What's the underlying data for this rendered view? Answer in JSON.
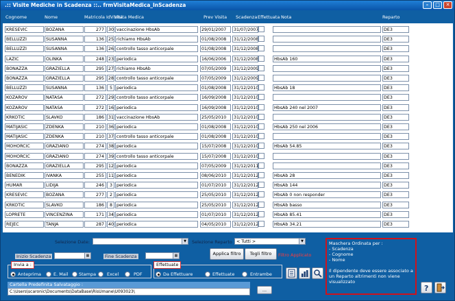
{
  "window": {
    "title": ".:: Visite Mediche in Scadenza ::..   frmVisitaMedica_InScadenza"
  },
  "table": {
    "headers": [
      "Cognome",
      "Nome",
      "Matricola",
      "IdVisita",
      "Visita Medica",
      "Prev Visita",
      "Scadenza",
      "Effettuata",
      "Nota",
      "Reparto"
    ],
    "rows": [
      [
        "KRESEVIC",
        "BOZANA",
        "277",
        "30",
        "vaccinazione HbsAb",
        "29/01/2007",
        "31/07/2007",
        "",
        "DE3"
      ],
      [
        "BELLUZZI",
        "SUSANNA",
        "136",
        "25",
        "richiamo HbsAb",
        "01/08/2008",
        "31/12/2008",
        "",
        "DE3"
      ],
      [
        "BELLUZZI",
        "SUSANNA",
        "136",
        "26",
        "controllo tasso anticorpale",
        "01/08/2008",
        "31/12/2008",
        "",
        "DE3"
      ],
      [
        "LAZIC",
        "OLINKA",
        "248",
        "23",
        "periodica",
        "16/06/2006",
        "31/12/2008",
        "HbsAb 160",
        "DE3"
      ],
      [
        "BONAZZA",
        "GRAZIELLA",
        "295",
        "27",
        "richiamo HbsAb",
        "07/05/2009",
        "31/12/2009",
        "",
        "DE3"
      ],
      [
        "BONAZZA",
        "GRAZIELLA",
        "295",
        "28",
        "controllo tasso anticorpale",
        "07/05/2009",
        "31/12/2009",
        "",
        "DE3"
      ],
      [
        "BELLUZZI",
        "SUSANNA",
        "136",
        "5",
        "periodica",
        "01/08/2008",
        "31/12/2010",
        "HbsAb 18",
        "DE3"
      ],
      [
        "KOZAROV",
        "NATASA",
        "272",
        "29",
        "controllo tasso anticorpale",
        "16/09/2008",
        "31/12/2010",
        "",
        "DE3"
      ],
      [
        "KOZAROV",
        "NATASA",
        "272",
        "16",
        "periodica",
        "16/09/2008",
        "31/12/2010",
        "HbsAb 240 nel 2007",
        "DE3"
      ],
      [
        "KRKOTIC",
        "SLAVKO",
        "186",
        "31",
        "vaccinazione HbsAb",
        "25/05/2010",
        "31/12/2010",
        "",
        "DE3"
      ],
      [
        "MATIJASIC",
        "ZDENKA",
        "210",
        "36",
        "periodica",
        "01/08/2008",
        "31/12/2010",
        "HbsAb 250 nel 2006",
        "DE3"
      ],
      [
        "MATIJASIC",
        "ZDENKA",
        "210",
        "37",
        "controllo tasso anticorpale",
        "01/08/2008",
        "31/12/2010",
        "",
        "DE3"
      ],
      [
        "MOHORCIC",
        "GRAZIANO",
        "274",
        "38",
        "periodica",
        "15/07/2008",
        "31/12/2010",
        "HbsAb 54.85",
        "DE3"
      ],
      [
        "MOHORCIC",
        "GRAZIANO",
        "274",
        "39",
        "controllo tasso anticorpale",
        "15/07/2008",
        "31/12/2010",
        "",
        "DE3"
      ],
      [
        "BONAZZA",
        "GRAZIELLA",
        "295",
        "12",
        "periodica",
        "07/05/2009",
        "31/12/2011",
        "",
        "DE3"
      ],
      [
        "BENEDIK",
        "IVANKA",
        "255",
        "11",
        "periodica",
        "08/06/2010",
        "31/12/2012",
        "HbsAb 28",
        "DE3"
      ],
      [
        "HUMAR",
        "LIDIJA",
        "246",
        "3",
        "periodica",
        "01/07/2010",
        "31/12/2012",
        "HbsAb 144",
        "DE3"
      ],
      [
        "KRESEVIC",
        "BOZANA",
        "277",
        "2",
        "periodica",
        "25/05/2010",
        "31/12/2012",
        "HbsAb 0 non responder",
        "DE3"
      ],
      [
        "KRKOTIC",
        "SLAVKO",
        "186",
        "8",
        "periodica",
        "25/05/2010",
        "31/12/2012",
        "HbsAb basso",
        "DE3"
      ],
      [
        "LOPRETE",
        "VINCENZINA",
        "171",
        "34",
        "periodica",
        "01/07/2010",
        "31/12/2012",
        "HbsAb 85.41",
        "DE3"
      ],
      [
        "REJEC",
        "TANJA",
        "287",
        "40",
        "periodica",
        "04/05/2010",
        "31/12/2012",
        "HbsAb 34.21",
        "DE3"
      ]
    ]
  },
  "filters": {
    "selezione_date_label": "Selezione Date:",
    "selezione_reparto_label": "Selezione Reparto",
    "reparto_value": "<  Tutti  >",
    "inizio_scadenza_label": "Inizio Scadenza",
    "fine_scadenza_label": "Fine Scadenza",
    "applica_filtro": "Applica filtro",
    "togli_filtro": "Togli filtro",
    "filtro_applicato": "Filtro Applicato"
  },
  "invia": {
    "title": "Invia a :",
    "options": [
      "Anteprima",
      "E. Mail",
      "Stampa",
      "Excel",
      "PDF"
    ],
    "selected": "Anteprima"
  },
  "effettuate": {
    "title": "Effettuate",
    "options": [
      "Da Effettuare",
      "Effettuate",
      "Entrambe"
    ],
    "selected": "Da Effettuare"
  },
  "cartella": {
    "label": "Cartella Predefinita Salvataggio :",
    "path": "C:\\Users\\scaronic\\Documents\\DataBase\\RisUmane\\U093023\\",
    "browse": "..."
  },
  "note_box": {
    "lines": [
      "Maschera Ordinata per :",
      "- Scadenza",
      "- Cognome",
      "- Nome",
      "",
      "Il dipendente deve essere associato a",
      "un Reparto altrimenti non viene",
      "visualizzato"
    ]
  },
  "icons": [
    "report-icon",
    "chart-icon",
    "search-icon",
    "help-icon",
    "exit-icon"
  ]
}
